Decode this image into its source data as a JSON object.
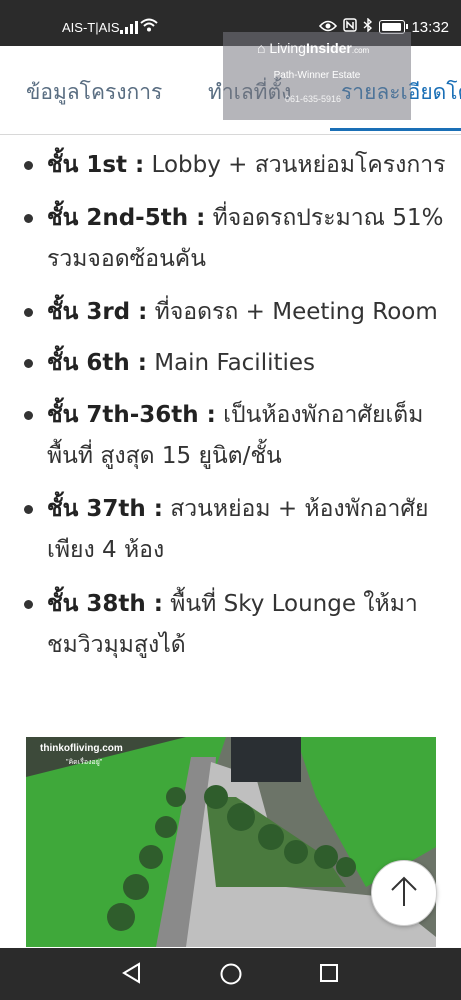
{
  "status": {
    "carrier": "AIS-T|AIS",
    "time": "13:32"
  },
  "tabs": [
    {
      "label": "ข้อมูลโครงการ",
      "active": false
    },
    {
      "label": "ทำเลที่ตั้ง",
      "active": false
    },
    {
      "label": "รายละเอียดโค",
      "active": true
    }
  ],
  "watermark": {
    "brand_a": "Living",
    "brand_b": "Insider",
    "brand_c": ".com",
    "agent": "Path-Winner Estate",
    "phone": "061-635-5916"
  },
  "floors": [
    {
      "key": "ชั้น 1st :",
      "text": " Lobby + สวนหย่อมโครงการ"
    },
    {
      "key": "ชั้น 2nd-5th :",
      "text": " ที่จอดรถประมาณ 51% รวมจอดซ้อนคัน"
    },
    {
      "key": "ชั้น 3rd :",
      "text": " ที่จอดรถ + Meeting Room"
    },
    {
      "key": "ชั้น 6th :",
      "text": " Main Facilities"
    },
    {
      "key": "ชั้น 7th-36th :",
      "text": " เป็นห้องพักอาศัยเต็มพื้นที่ สูงสุด 15 ยูนิต/ชั้น"
    },
    {
      "key": "ชั้น 37th :",
      "text": " สวนหย่อม + ห้องพักอาศัยเพียง 4 ห้อง"
    },
    {
      "key": "ชั้น 38th :",
      "text": " พื้นที่ Sky Lounge ให้มาชมวิวมุมสูงได้"
    }
  ],
  "photo": {
    "label": "thinkofliving.com",
    "sub": "\"คิดเรื่องอยู่\""
  },
  "icons": {
    "scroll_top": "arrow-up-icon",
    "nav_back": "back-triangle-icon",
    "nav_home": "home-circle-icon",
    "nav_recents": "recents-square-icon"
  },
  "colors": {
    "accent": "#1a6fb6",
    "tab_inactive": "#5a6e82",
    "bar": "#2b2b2b"
  }
}
